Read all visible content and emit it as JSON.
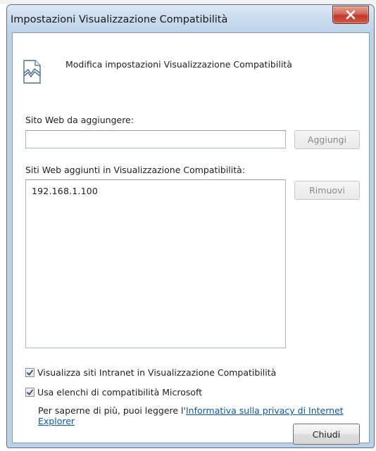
{
  "window": {
    "title": "Impostazioni Visualizzazione Compatibilità",
    "close_icon": "close-x-icon"
  },
  "header": {
    "icon": "broken-page-icon",
    "text": "Modifica impostazioni Visualizzazione Compatibilità"
  },
  "add_site": {
    "label": "Sito Web da aggiungere:",
    "value": "",
    "placeholder": "",
    "button_label": "Aggiungi"
  },
  "site_list": {
    "label": "Siti Web aggiunti in Visualizzazione Compatibilità:",
    "items": [
      "192.168.1.100"
    ],
    "remove_label": "Rimuovi"
  },
  "options": {
    "intranet_label": "Visualizza siti Intranet in Visualizzazione Compatibilità",
    "intranet_checked": true,
    "microsoft_lists_label": "Usa elenchi di compatibilità Microsoft",
    "microsoft_lists_checked": true
  },
  "info": {
    "prefix": "Per saperne di più, puoi leggere l'",
    "link_text": "Informativa sulla privacy di Internet Explorer"
  },
  "footer": {
    "close_label": "Chiudi"
  }
}
